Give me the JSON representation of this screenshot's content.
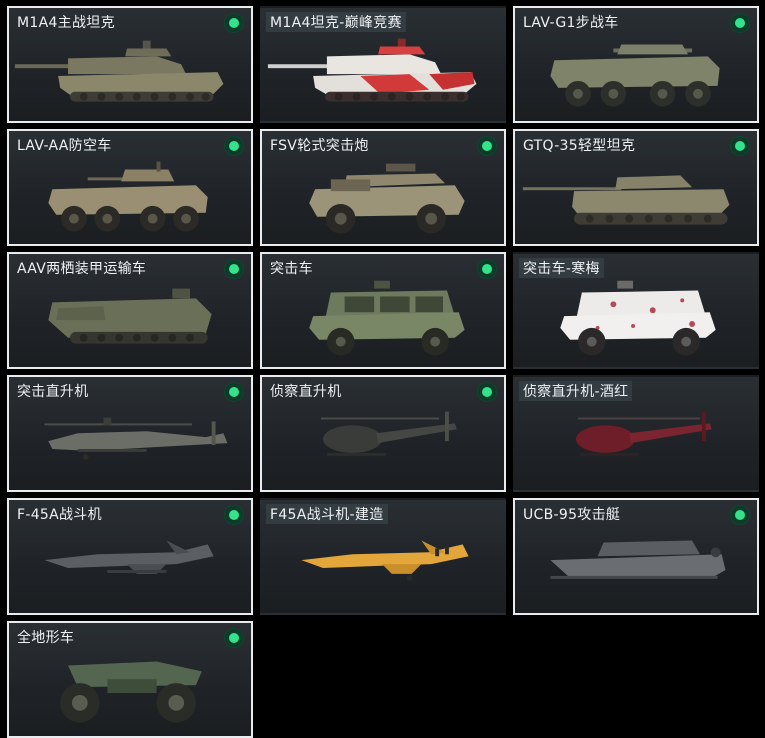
{
  "colors": {
    "background": "#000000",
    "card": "#23272b",
    "selected_border": "#e8ecef",
    "status_dot": "#33e28a"
  },
  "vehicles": [
    {
      "name": "M1A4主战坦克",
      "selected": true,
      "icon": "tank-icon"
    },
    {
      "name": "M1A4坦克-巅峰竞赛",
      "selected": false,
      "icon": "tank-racing-icon"
    },
    {
      "name": "LAV-G1步战车",
      "selected": true,
      "icon": "ifv-icon"
    },
    {
      "name": "LAV-AA防空车",
      "selected": true,
      "icon": "aa-vehicle-icon"
    },
    {
      "name": "FSV轮式突击炮",
      "selected": true,
      "icon": "wheeled-gun-icon"
    },
    {
      "name": "GTQ-35轻型坦克",
      "selected": true,
      "icon": "light-tank-icon"
    },
    {
      "name": "AAV两栖装甲运输车",
      "selected": true,
      "icon": "amphibious-vehicle-icon"
    },
    {
      "name": "突击车",
      "selected": true,
      "icon": "assault-car-icon"
    },
    {
      "name": "突击车-寒梅",
      "selected": false,
      "icon": "assault-car-plum-icon"
    },
    {
      "name": "突击直升机",
      "selected": true,
      "icon": "attack-helicopter-icon"
    },
    {
      "name": "侦察直升机",
      "selected": true,
      "icon": "scout-helicopter-icon"
    },
    {
      "name": "侦察直升机-酒红",
      "selected": false,
      "icon": "scout-helicopter-wine-icon"
    },
    {
      "name": "F-45A战斗机",
      "selected": true,
      "icon": "fighter-jet-icon"
    },
    {
      "name": "F45A战斗机-建造",
      "selected": false,
      "icon": "fighter-jet-construction-icon"
    },
    {
      "name": "UCB-95攻击艇",
      "selected": true,
      "icon": "attack-boat-icon"
    },
    {
      "name": "全地形车",
      "selected": true,
      "icon": "atv-icon"
    }
  ]
}
